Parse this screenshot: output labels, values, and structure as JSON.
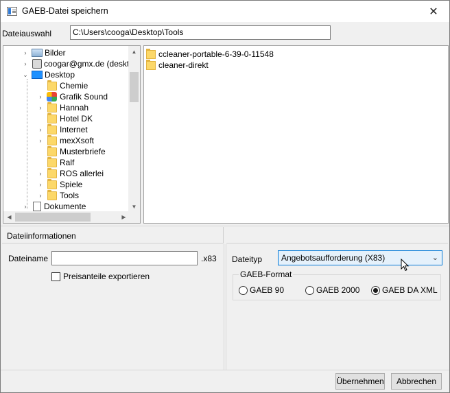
{
  "window": {
    "title": "GAEB-Datei speichern",
    "close_glyph": "✕",
    "icon": "app-window-icon"
  },
  "selection": {
    "label": "Dateiauswahl",
    "path": "C:\\Users\\cooga\\Desktop\\Tools"
  },
  "tree": {
    "items": [
      {
        "label": "Bilder",
        "icon": "pictures-icon",
        "expander": "›"
      },
      {
        "label": "coogar@gmx.de (deskto",
        "icon": "network-drive-icon",
        "expander": "›"
      },
      {
        "label": "Desktop",
        "icon": "desktop-icon",
        "expander": "⌄"
      },
      {
        "label": "Chemie",
        "icon": "folder-icon",
        "expander": ""
      },
      {
        "label": "Grafik Sound",
        "icon": "multimedia-folder-icon",
        "expander": "›"
      },
      {
        "label": "Hannah",
        "icon": "folder-icon",
        "expander": "›"
      },
      {
        "label": "Hotel DK",
        "icon": "folder-icon",
        "expander": ""
      },
      {
        "label": "Internet",
        "icon": "folder-icon",
        "expander": "›"
      },
      {
        "label": "mexXsoft",
        "icon": "folder-icon",
        "expander": "›"
      },
      {
        "label": "Musterbriefe",
        "icon": "folder-icon",
        "expander": ""
      },
      {
        "label": "Ralf",
        "icon": "folder-icon",
        "expander": ""
      },
      {
        "label": "ROS allerlei",
        "icon": "folder-icon",
        "expander": "›"
      },
      {
        "label": "Spiele",
        "icon": "folder-icon",
        "expander": "›"
      },
      {
        "label": "Tools",
        "icon": "folder-icon",
        "expander": "›"
      },
      {
        "label": "Dokumente",
        "icon": "documents-icon",
        "expander": "›"
      }
    ]
  },
  "files": {
    "items": [
      {
        "label": "ccleaner-portable-6-39-0-11548",
        "icon": "folder-icon"
      },
      {
        "label": "cleaner-direkt",
        "icon": "folder-icon"
      }
    ]
  },
  "info": {
    "section_title": "Dateiinformationen",
    "name_label": "Dateiname",
    "name_value": "",
    "extension": ".x83",
    "checkbox_label": "Preisanteile exportieren",
    "checkbox_checked": false
  },
  "type": {
    "label": "Dateityp",
    "selected": "Angebotsaufforderung (X83)"
  },
  "format": {
    "legend": "GAEB-Format",
    "options": [
      {
        "label": "GAEB 90",
        "checked": false
      },
      {
        "label": "GAEB 2000",
        "checked": false
      },
      {
        "label": "GAEB DA XML",
        "checked": true
      }
    ]
  },
  "buttons": {
    "apply": "Übernehmen",
    "cancel": "Abbrechen"
  }
}
